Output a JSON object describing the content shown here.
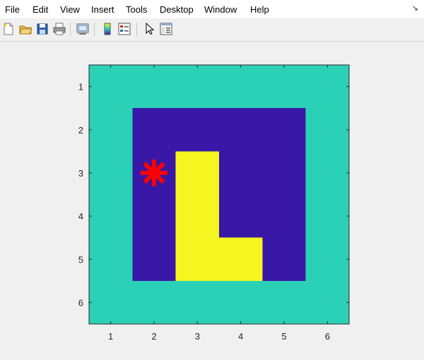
{
  "menu": {
    "items": [
      "File",
      "Edit",
      "View",
      "Insert",
      "Tools",
      "Desktop",
      "Window",
      "Help"
    ],
    "dock_glyph": "↘"
  },
  "toolbar": {
    "buttons": [
      {
        "icon": "new-figure-icon"
      },
      {
        "icon": "open-file-icon"
      },
      {
        "icon": "save-icon"
      },
      {
        "icon": "print-icon"
      },
      {
        "icon": "link-plot-icon"
      },
      {
        "icon": "insert-colorbar-icon"
      },
      {
        "icon": "insert-legend-icon"
      },
      {
        "icon": "edit-plot-pointer-icon"
      },
      {
        "icon": "property-inspector-icon"
      }
    ]
  },
  "chart_data": {
    "type": "heatmap",
    "title": "",
    "xlabel": "",
    "ylabel": "",
    "x_ticks": [
      1,
      2,
      3,
      4,
      5,
      6
    ],
    "y_ticks": [
      1,
      2,
      3,
      4,
      5,
      6
    ],
    "xlim": [
      0.5,
      6.5
    ],
    "ylim": [
      0.5,
      6.5
    ],
    "y_direction": "reverse",
    "grid": false,
    "matrix": [
      [
        1,
        1,
        1,
        1,
        1,
        1
      ],
      [
        1,
        0,
        0,
        0,
        0,
        1
      ],
      [
        1,
        0,
        2,
        0,
        0,
        1
      ],
      [
        1,
        0,
        2,
        0,
        0,
        1
      ],
      [
        1,
        0,
        2,
        2,
        0,
        1
      ],
      [
        1,
        1,
        1,
        1,
        1,
        1
      ]
    ],
    "colormap": {
      "0": "#3a18a7",
      "1": "#2bd1b6",
      "2": "#f7f51f"
    },
    "marker": {
      "x": 2,
      "y": 3,
      "symbol": "*",
      "color": "#ff0000"
    }
  }
}
